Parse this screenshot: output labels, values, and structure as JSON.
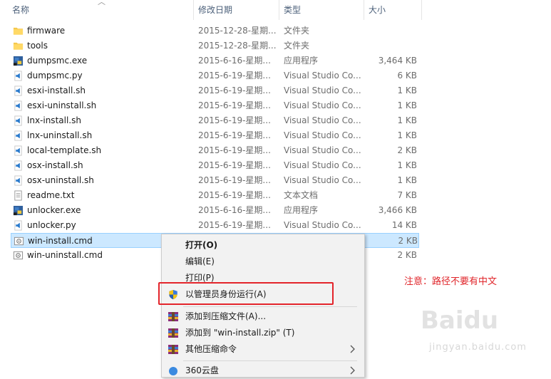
{
  "columns": {
    "name": "名称",
    "date": "修改日期",
    "type": "类型",
    "size": "大小"
  },
  "files": [
    {
      "name": "firmware",
      "date": "2015-12-28-星期...",
      "type": "文件夹",
      "size": "",
      "icon": "folder-icon"
    },
    {
      "name": "tools",
      "date": "2015-12-28-星期...",
      "type": "文件夹",
      "size": "",
      "icon": "folder-icon"
    },
    {
      "name": "dumpsmc.exe",
      "date": "2015-6-16-星期...",
      "type": "应用程序",
      "size": "3,464 KB",
      "icon": "python-exe-icon"
    },
    {
      "name": "dumpsmc.py",
      "date": "2015-6-19-星期...",
      "type": "Visual Studio Co...",
      "size": "6 KB",
      "icon": "vscode-file-icon"
    },
    {
      "name": "esxi-install.sh",
      "date": "2015-6-19-星期...",
      "type": "Visual Studio Co...",
      "size": "1 KB",
      "icon": "vscode-file-icon"
    },
    {
      "name": "esxi-uninstall.sh",
      "date": "2015-6-19-星期...",
      "type": "Visual Studio Co...",
      "size": "1 KB",
      "icon": "vscode-file-icon"
    },
    {
      "name": "lnx-install.sh",
      "date": "2015-6-19-星期...",
      "type": "Visual Studio Co...",
      "size": "1 KB",
      "icon": "vscode-file-icon"
    },
    {
      "name": "lnx-uninstall.sh",
      "date": "2015-6-19-星期...",
      "type": "Visual Studio Co...",
      "size": "1 KB",
      "icon": "vscode-file-icon"
    },
    {
      "name": "local-template.sh",
      "date": "2015-6-19-星期...",
      "type": "Visual Studio Co...",
      "size": "2 KB",
      "icon": "vscode-file-icon"
    },
    {
      "name": "osx-install.sh",
      "date": "2015-6-19-星期...",
      "type": "Visual Studio Co...",
      "size": "1 KB",
      "icon": "vscode-file-icon"
    },
    {
      "name": "osx-uninstall.sh",
      "date": "2015-6-19-星期...",
      "type": "Visual Studio Co...",
      "size": "1 KB",
      "icon": "vscode-file-icon"
    },
    {
      "name": "readme.txt",
      "date": "2015-6-19-星期...",
      "type": "文本文档",
      "size": "7 KB",
      "icon": "text-file-icon"
    },
    {
      "name": "unlocker.exe",
      "date": "2015-6-16-星期...",
      "type": "应用程序",
      "size": "3,466 KB",
      "icon": "python-exe-icon"
    },
    {
      "name": "unlocker.py",
      "date": "2015-6-19-星期...",
      "type": "Visual Studio Co...",
      "size": "14 KB",
      "icon": "vscode-file-icon"
    },
    {
      "name": "win-install.cmd",
      "date": "",
      "type": "",
      "size": "2 KB",
      "icon": "cmd-file-icon",
      "selected": true
    },
    {
      "name": "win-uninstall.cmd",
      "date": "",
      "type": "",
      "size": "2 KB",
      "icon": "cmd-file-icon"
    }
  ],
  "context_menu": {
    "open": "打开(O)",
    "edit": "编辑(E)",
    "print": "打印(P)",
    "run_as_admin": "以管理员身份运行(A)",
    "add_to_archive": "添加到压缩文件(A)...",
    "add_to_zip": "添加到 \"win-install.zip\" (T)",
    "other_compress": "其他压缩命令",
    "partial_360": "360云盘"
  },
  "note": "注意：路径不要有中文",
  "watermark": {
    "brand": "Baidu",
    "sub": "jingyan.baidu.com"
  },
  "colors": {
    "selection_bg": "#cce8ff",
    "annotation_red": "#e3242b",
    "header_text": "#4c607a"
  }
}
